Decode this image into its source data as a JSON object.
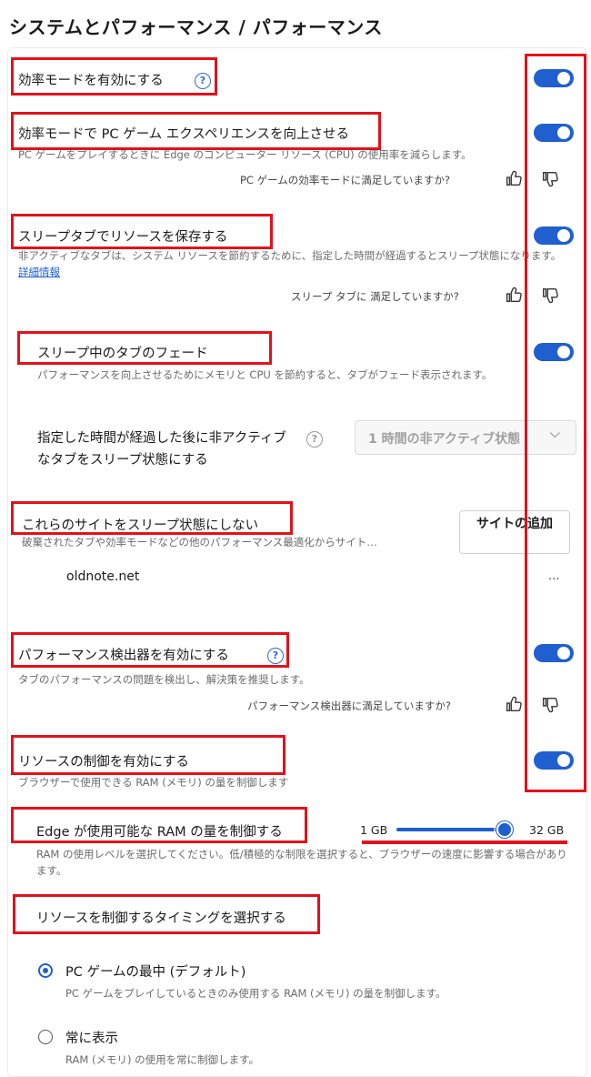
{
  "header": {
    "title": "システムとパフォーマンス / パフォーマンス"
  },
  "efficiency": {
    "label": "効率モードを有効にする",
    "help": "?"
  },
  "gaming": {
    "label": "効率モードで PC ゲーム エクスペリエンスを向上させる",
    "desc": "PC ゲームをプレイするときに Edge のコンピューター リソース (CPU) の使用率を減らします。",
    "feedback": "PC ゲームの効率モードに満足していますか?"
  },
  "sleeping_tabs": {
    "label": "スリープタブでリソースを保存する",
    "desc": "非アクティブなタブは、システム リソースを節約するために、指定した時間が経過するとスリープ状態になります。",
    "link": "詳細情報",
    "feedback": "スリープ タブに 満足していますか?"
  },
  "fade": {
    "label": "スリープ中のタブのフェード",
    "desc": "パフォーマンスを向上させるためにメモリと CPU を節約すると、タブがフェード表示されます。"
  },
  "inactive": {
    "label": "指定した時間が経過した後に非アクティブなタブをスリープ状態にする",
    "help": "?",
    "select_value": "1 時間の非アクティブ状態",
    "chevron": "⌵"
  },
  "never_sleep": {
    "label": "これらのサイトをスリープ状態にしない",
    "desc": "破棄されたタブや効率モードなどの他のパフォーマンス最適化からサイト…",
    "add_button": "サイトの追加",
    "site": "oldnote.net",
    "more": "..."
  },
  "detector": {
    "label": "パフォーマンス検出器を有効にする",
    "help": "?",
    "desc": "タブのパフォーマンスの問題を検出し、解決策を推奨します。",
    "feedback": "パフォーマンス検出器に満足していますか?"
  },
  "resource_control": {
    "label": "リソースの制御を有効にする",
    "desc": "ブラウザーで使用できる RAM (メモリ) の量を制御します"
  },
  "ram_limit": {
    "label": "Edge が使用可能な RAM の量を制御する",
    "min": "1 GB",
    "max": "32 GB",
    "value_fraction": 0.85,
    "desc": "RAM の使用レベルを選択してください。低/積極的な制限を選択すると、ブラウザーの速度に影響する場合があります。"
  },
  "timing": {
    "label": "リソースを制御するタイミングを選択する",
    "option1_label": "PC ゲームの最中 (デフォルト)",
    "option1_desc": "PC ゲームをプレイしているときのみ使用する RAM (メモリ) の量を制御します。",
    "option2_label": "常に表示",
    "option2_desc": "RAM (メモリ) の使用を常に制御します。"
  },
  "colors": {
    "accent": "#1f5fcf",
    "highlight": "#e3111b"
  },
  "icons": {
    "help": "help-circle-icon",
    "like": "thumbs-up-icon",
    "dislike": "thumbs-down-icon"
  }
}
